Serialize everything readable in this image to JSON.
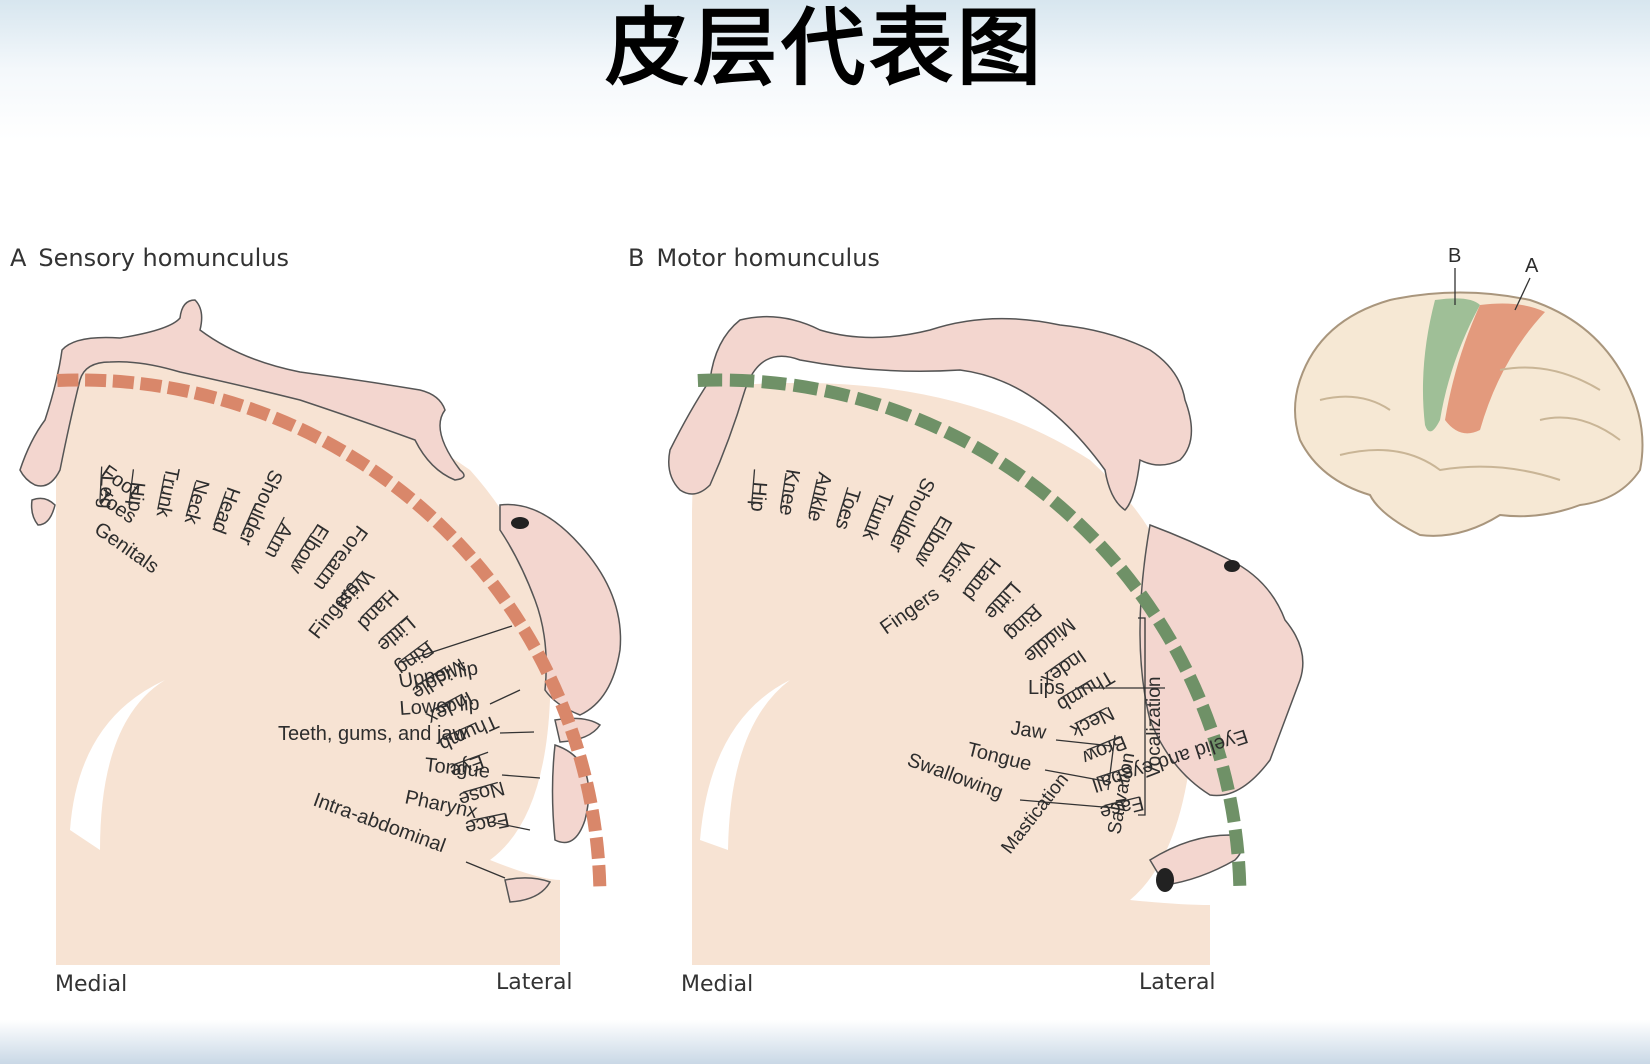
{
  "title": "皮层代表图",
  "panel_a": {
    "letter": "A",
    "title": "Sensory homunculus",
    "medial": "Medial",
    "lateral": "Lateral",
    "radial_labels": [
      "Leg",
      "Hip",
      "Trunk",
      "Neck",
      "Head",
      "Shoulder",
      "Arm",
      "Elbow",
      "Forearm",
      "Wrist",
      "Hand",
      "Little",
      "Ring",
      "Middle",
      "Index",
      "Thumb",
      "Eye",
      "Nose",
      "Face"
    ],
    "inner_labels": [
      "Foot",
      "Toes",
      "Genitals",
      "Fingers"
    ],
    "lower_labels": [
      "Upper lip",
      "Lower lip",
      "Teeth, gums, and jaw",
      "Tongue",
      "Pharynx",
      "Intra-abdominal"
    ],
    "strip_color": "#d9876a"
  },
  "panel_b": {
    "letter": "B",
    "title": "Motor homunculus",
    "medial": "Medial",
    "lateral": "Lateral",
    "radial_labels": [
      "Hip",
      "Knee",
      "Ankle",
      "Toes",
      "Trunk",
      "Shoulder",
      "Elbow",
      "Wrist",
      "Hand",
      "Little",
      "Ring",
      "Middle",
      "Index",
      "Thumb",
      "Neck",
      "Brow",
      "Eyelid and eyeball",
      "Face",
      "Fingers"
    ],
    "lower_labels": [
      "Lips",
      "Jaw",
      "Tongue",
      "Swallowing"
    ],
    "bracket_labels": [
      "Vocalization",
      "Salivation",
      "Mastication"
    ],
    "strip_color": "#6f9167"
  },
  "brain_inset": {
    "label_b": "B",
    "label_a": "A",
    "motor_color": "#9fbf97",
    "sensory_color": "#e39a7d"
  },
  "background_color": "#f7e3d3"
}
